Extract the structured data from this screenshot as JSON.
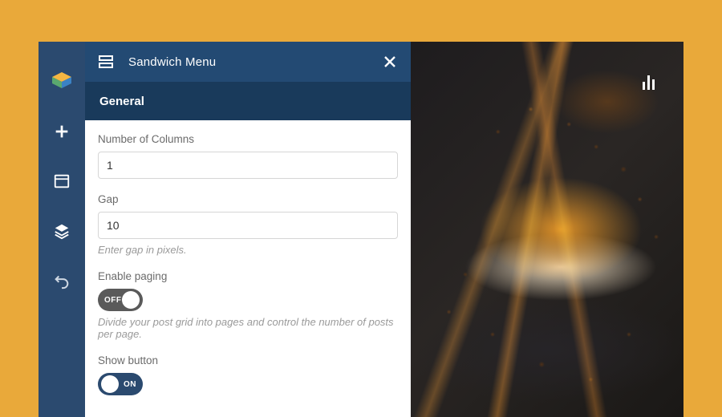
{
  "panel": {
    "title": "Sandwich Menu",
    "section": "General",
    "fields": {
      "columns": {
        "label": "Number of Columns",
        "value": "1"
      },
      "gap": {
        "label": "Gap",
        "value": "10",
        "hint": "Enter gap in pixels."
      },
      "paging": {
        "label": "Enable paging",
        "hint": "Divide your post grid into pages and control the number of posts per page.",
        "state": "OFF"
      },
      "showButton": {
        "label": "Show button",
        "state": "ON"
      }
    }
  },
  "toggles": {
    "off": "OFF",
    "on": "ON"
  }
}
